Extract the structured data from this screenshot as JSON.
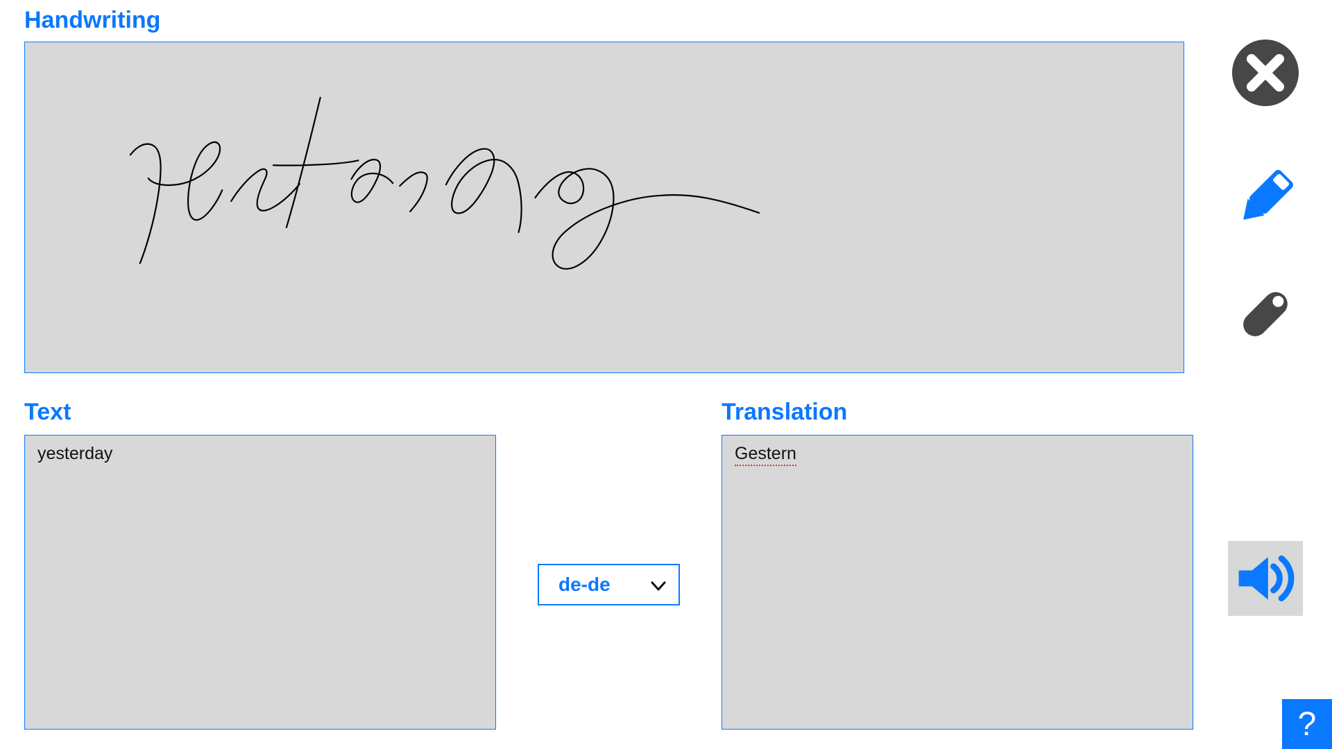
{
  "headings": {
    "handwriting": "Handwriting",
    "text": "Text",
    "translation": "Translation"
  },
  "handwriting": {
    "recognized_text": "yesterday"
  },
  "text_box": {
    "value": "yesterday"
  },
  "translation_box": {
    "value": "Gestern",
    "spellcheck_flag": true
  },
  "language_select": {
    "value": "de-de"
  },
  "buttons": {
    "clear": "clear",
    "pen": "pen",
    "eraser": "eraser",
    "speak": "speak",
    "help_label": "?"
  },
  "colors": {
    "accent": "#0a78ff",
    "panel": "#d8d8d8",
    "icon_dark": "#474747"
  }
}
